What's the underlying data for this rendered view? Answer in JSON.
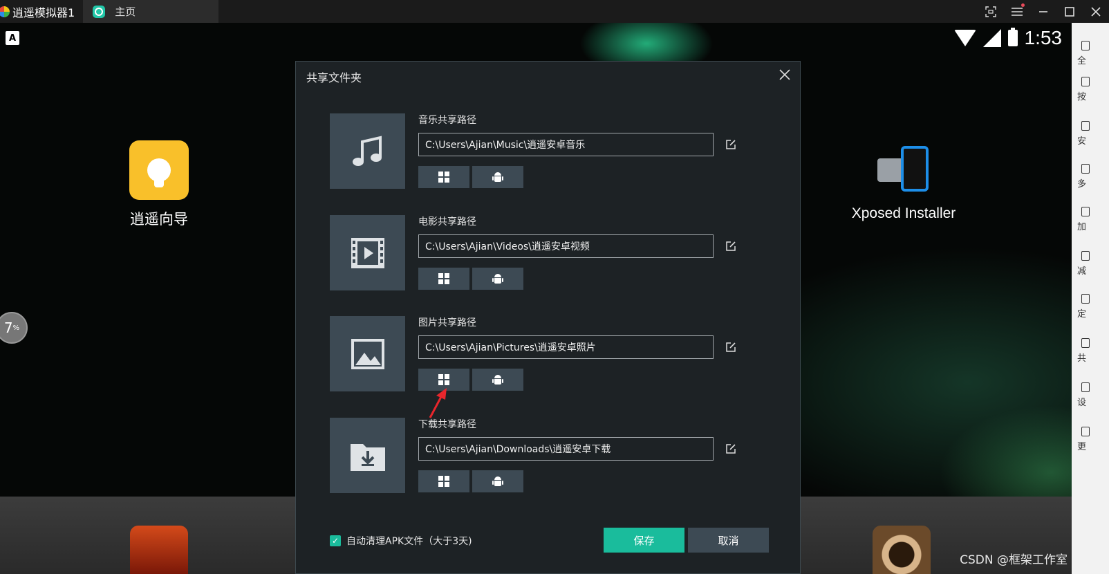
{
  "titlebar": {
    "app_tab": "逍遥模拟器1",
    "home_tab": "主页"
  },
  "statusbar": {
    "keyboard_indicator": "A",
    "time": "1:53"
  },
  "desktop": {
    "icons": [
      {
        "label": "逍遥向导",
        "icon": "lightbulb-icon"
      },
      {
        "label": "Xposed Installer",
        "icon": "xposed-puzzle-icon"
      }
    ],
    "progress_bubble": {
      "value": "7",
      "unit": "%"
    }
  },
  "sidebar": {
    "items": [
      "全",
      "按",
      "安",
      "多",
      "加",
      "减",
      "定",
      "共",
      "设",
      "更"
    ]
  },
  "dialog": {
    "title": "共享文件夹",
    "rows": [
      {
        "label": "音乐共享路径",
        "path": "C:\\Users\\Ajian\\Music\\逍遥安卓音乐",
        "icon": "music-note-icon"
      },
      {
        "label": "电影共享路径",
        "path": "C:\\Users\\Ajian\\Videos\\逍遥安卓视频",
        "icon": "film-icon"
      },
      {
        "label": "图片共享路径",
        "path": "C:\\Users\\Ajian\\Pictures\\逍遥安卓照片",
        "icon": "image-icon"
      },
      {
        "label": "下载共享路径",
        "path": "C:\\Users\\Ajian\\Downloads\\逍遥安卓下载",
        "icon": "download-folder-icon"
      }
    ],
    "auto_clean": {
      "checked": true,
      "label": "自动清理APK文件（大于3天)"
    },
    "save_label": "保存",
    "cancel_label": "取消"
  },
  "watermark": "CSDN @框架工作室",
  "colors": {
    "accent": "#1abc9c",
    "tile": "#3d4a54",
    "dialog_bg": "#1d2225"
  }
}
